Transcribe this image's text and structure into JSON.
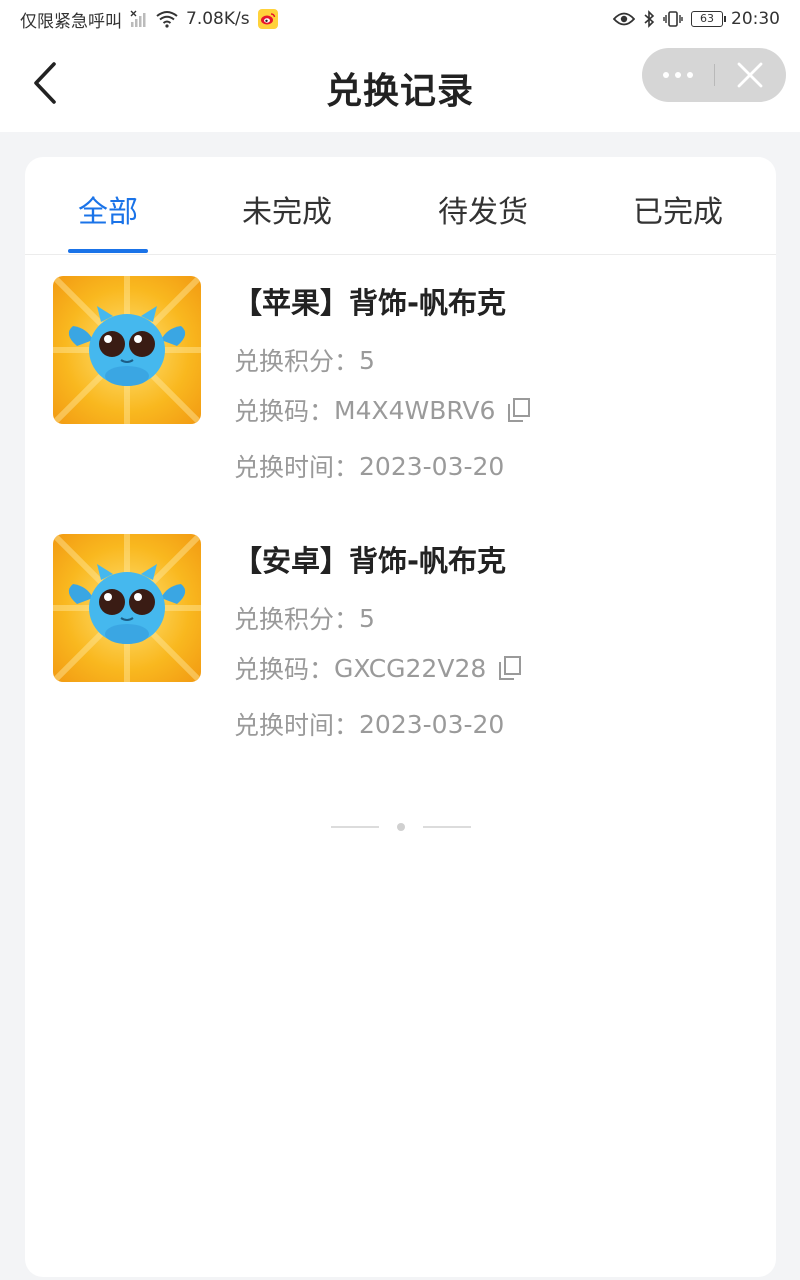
{
  "status_bar": {
    "left_text": "仅限紧急呼叫",
    "net_speed": "7.08K/s",
    "battery": "63",
    "time": "20:30"
  },
  "nav": {
    "title": "兑换记录"
  },
  "tabs": [
    {
      "label": "全部",
      "active": true
    },
    {
      "label": "未完成",
      "active": false
    },
    {
      "label": "待发货",
      "active": false
    },
    {
      "label": "已完成",
      "active": false
    }
  ],
  "records": [
    {
      "title": "【苹果】背饰-帆布克",
      "points_label": "兑换积分：",
      "points": "5",
      "code_label": "兑换码：",
      "code": "M4X4WBRV6",
      "time_label": "兑换时间：",
      "time": "2023-03-20"
    },
    {
      "title": "【安卓】背饰-帆布克",
      "points_label": "兑换积分：",
      "points": "5",
      "code_label": "兑换码：",
      "code": "GXCG22V28",
      "time_label": "兑换时间：",
      "time": "2023-03-20"
    }
  ],
  "colors": {
    "accent": "#1a73e8",
    "thumb_bg": "#f7b21f",
    "mascot": "#45b8ee"
  },
  "icons": [
    "back-icon",
    "more-icon",
    "close-icon",
    "copy-icon",
    "wifi-icon",
    "signal-icon",
    "eye-icon",
    "bluetooth-icon",
    "vibrate-icon",
    "battery-icon",
    "weibo-icon"
  ]
}
